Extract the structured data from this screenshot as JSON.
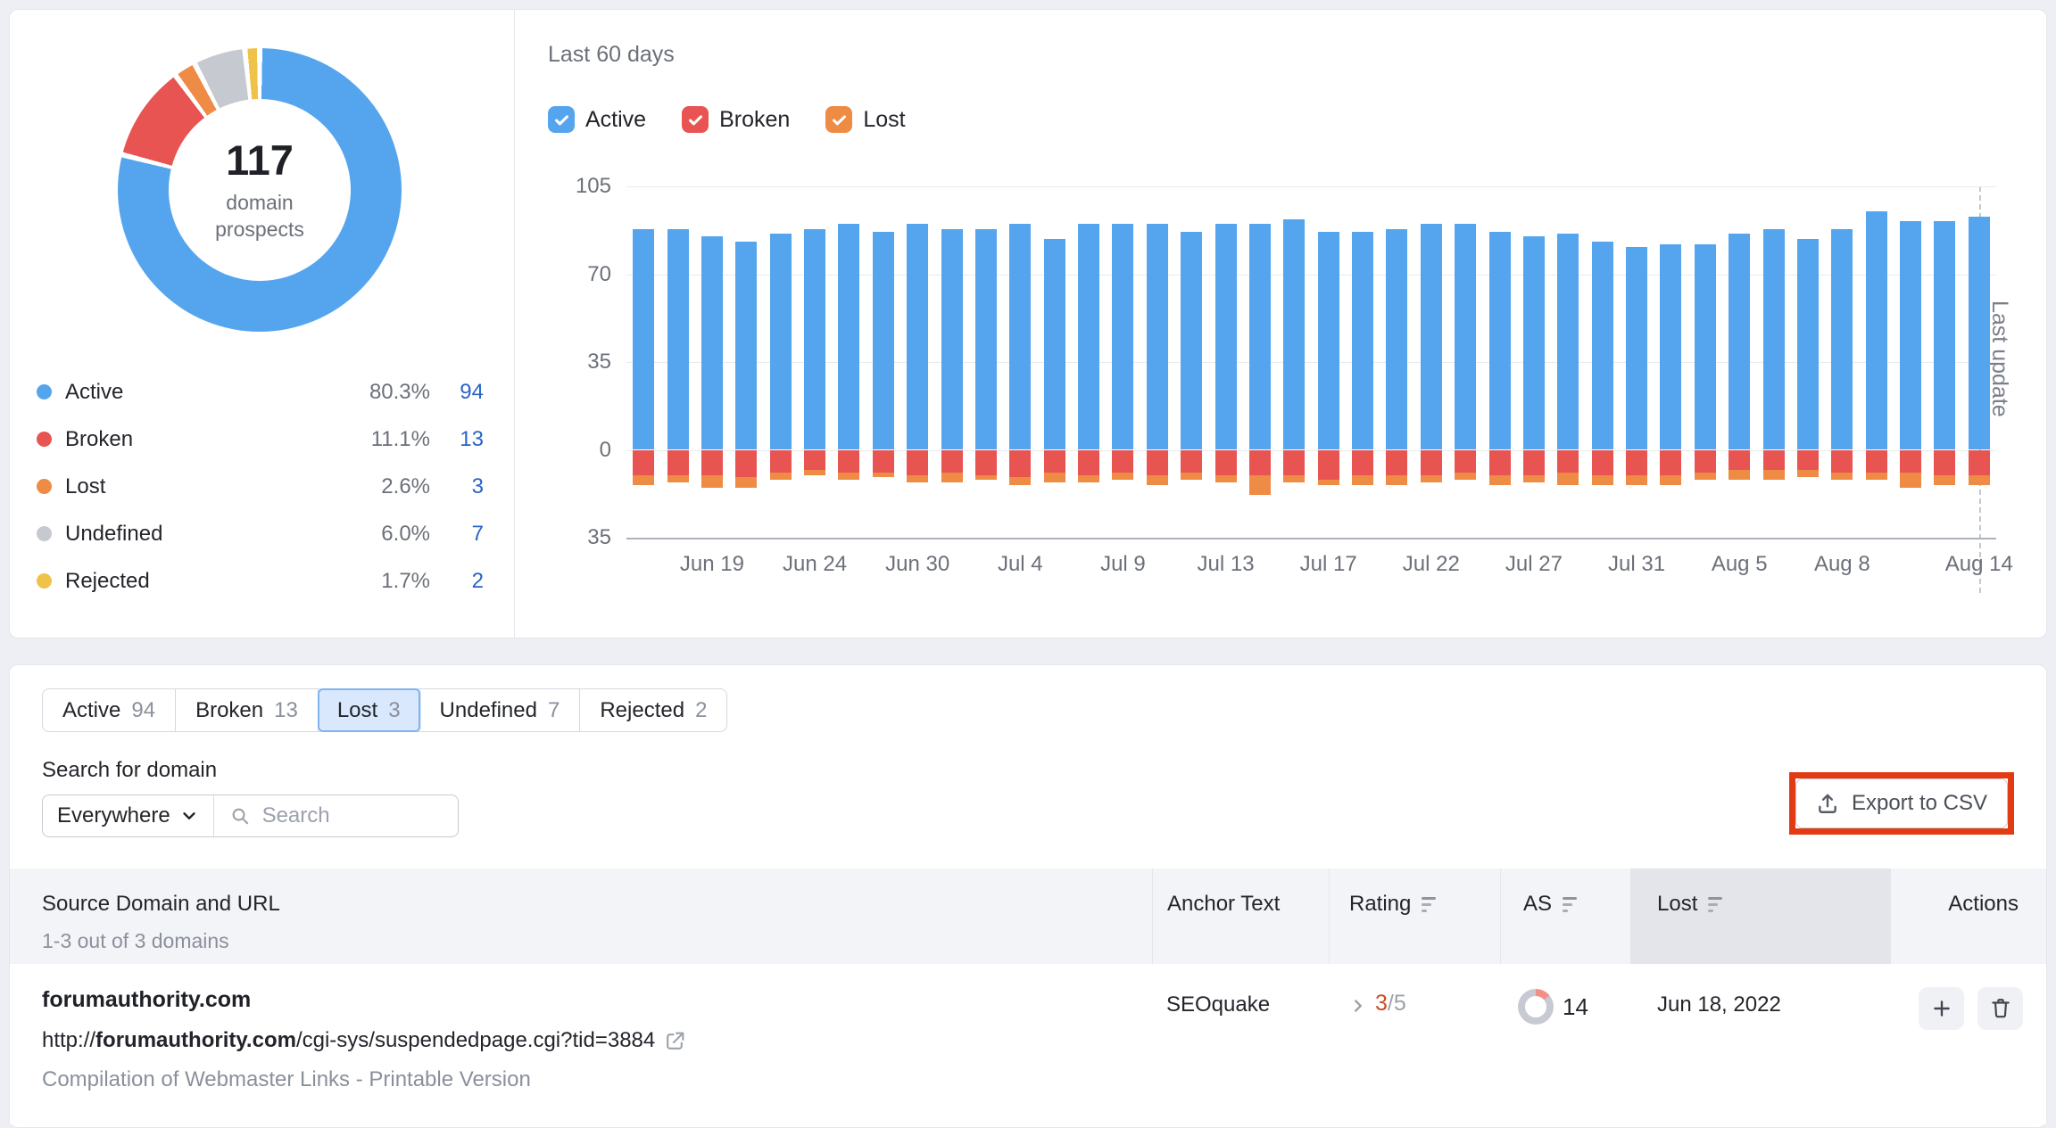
{
  "donut_card": {
    "center_value": "117",
    "center_label": "domain\nprospects",
    "legend": [
      {
        "label": "Active",
        "percent": "80.3%",
        "count": "94",
        "color": "#55A5EE"
      },
      {
        "label": "Broken",
        "percent": "11.1%",
        "count": "13",
        "color": "#E85452"
      },
      {
        "label": "Lost",
        "percent": "2.6%",
        "count": "3",
        "color": "#EE8B45"
      },
      {
        "label": "Undefined",
        "percent": "6.0%",
        "count": "7",
        "color": "#C6C9CF"
      },
      {
        "label": "Rejected",
        "percent": "1.7%",
        "count": "2",
        "color": "#EFC24A"
      }
    ]
  },
  "chart_card": {
    "title": "Last 60 days",
    "filters": [
      {
        "label": "Active",
        "color": "#55A5EE",
        "checked": true
      },
      {
        "label": "Broken",
        "color": "#E85452",
        "checked": true
      },
      {
        "label": "Lost",
        "color": "#EE8B45",
        "checked": true
      }
    ],
    "last_update_label": "Last update"
  },
  "chart_data": [
    {
      "type": "pie",
      "title": "117 domain prospects",
      "labels": [
        "Active",
        "Broken",
        "Lost",
        "Undefined",
        "Rejected"
      ],
      "values": [
        94,
        13,
        3,
        7,
        2
      ],
      "percents": [
        80.3,
        11.1,
        2.6,
        6.0,
        1.7
      ],
      "colors": [
        "#55A5EE",
        "#E85452",
        "#EE8B45",
        "#C6C9CF",
        "#EFC24A"
      ],
      "center_text": "117 domain prospects"
    },
    {
      "type": "bar",
      "stacked": true,
      "title": "Last 60 days",
      "ylim": [
        -35,
        105
      ],
      "yticks": [
        105,
        70,
        35,
        0,
        -35
      ],
      "ytick_labels": [
        "105",
        "70",
        "35",
        "0",
        "35"
      ],
      "grid": true,
      "x_label_indices": [
        2,
        5,
        8,
        11,
        14,
        17,
        20,
        23,
        26,
        29,
        32,
        35,
        39
      ],
      "x_labels": [
        "Jun 19",
        "Jun 24",
        "Jun 30",
        "Jul 4",
        "Jul 9",
        "Jul 13",
        "Jul 17",
        "Jul 22",
        "Jul 27",
        "Jul 31",
        "Aug 5",
        "Aug 8",
        "Aug 14"
      ],
      "series": [
        {
          "name": "Active",
          "color": "#55A5EE",
          "values": [
            88,
            88,
            85,
            83,
            86,
            88,
            90,
            87,
            90,
            88,
            88,
            90,
            84,
            90,
            90,
            90,
            87,
            90,
            90,
            92,
            87,
            87,
            88,
            90,
            90,
            87,
            85,
            86,
            83,
            81,
            82,
            82,
            86,
            88,
            84,
            88,
            95,
            91,
            91,
            93
          ]
        },
        {
          "name": "Broken",
          "color": "#E85452",
          "values": [
            -10,
            -10,
            -10,
            -11,
            -9,
            -8,
            -9,
            -9,
            -10,
            -9,
            -10,
            -11,
            -9,
            -10,
            -9,
            -10,
            -9,
            -10,
            -10,
            -10,
            -12,
            -10,
            -10,
            -10,
            -9,
            -10,
            -10,
            -9,
            -10,
            -10,
            -10,
            -9,
            -8,
            -8,
            -8,
            -9,
            -9,
            -9,
            -10,
            -10
          ]
        },
        {
          "name": "Lost",
          "color": "#EE8B45",
          "values": [
            -4,
            -3,
            -5,
            -4,
            -3,
            -2,
            -3,
            -2,
            -3,
            -4,
            -2,
            -3,
            -4,
            -3,
            -3,
            -4,
            -3,
            -3,
            -8,
            -3,
            -2,
            -4,
            -4,
            -3,
            -3,
            -4,
            -3,
            -5,
            -4,
            -4,
            -4,
            -3,
            -4,
            -4,
            -3,
            -3,
            -3,
            -6,
            -4,
            -4
          ]
        }
      ],
      "annotations": [
        "Last update"
      ]
    }
  ],
  "tabs": [
    {
      "label": "Active",
      "count": "94",
      "selected": false
    },
    {
      "label": "Broken",
      "count": "13",
      "selected": false
    },
    {
      "label": "Lost",
      "count": "3",
      "selected": true
    },
    {
      "label": "Undefined",
      "count": "7",
      "selected": false
    },
    {
      "label": "Rejected",
      "count": "2",
      "selected": false
    }
  ],
  "search": {
    "label": "Search for domain",
    "scope_value": "Everywhere",
    "placeholder": "Search"
  },
  "export": {
    "label": "Export to CSV"
  },
  "table": {
    "header": {
      "source": "Source Domain and URL",
      "source_sub": "1-3 out of 3 domains",
      "anchor": "Anchor Text",
      "rating": "Rating",
      "as": "AS",
      "lost": "Lost",
      "actions": "Actions"
    },
    "rows": [
      {
        "domain": "forumauthority.com",
        "url_prefix": "http://",
        "url_domain": "forumauthority.com",
        "url_path": "/cgi-sys/suspendedpage.cgi?tid=3884",
        "title": "Compilation of Webmaster Links - Printable Version",
        "anchor": "SEOquake",
        "rating_value": "3",
        "rating_total": "/5",
        "as_score": 14,
        "lost_date": "Jun 18, 2022"
      }
    ]
  },
  "colors": {
    "active_blue": "#55A5EE",
    "broken_red": "#E85452",
    "lost_orange": "#EE8B45",
    "undefined_grey": "#C6C9CF",
    "rejected_yellow": "#EFC24A",
    "link_blue": "#2A63C6",
    "annotation_red": "#E23A12",
    "rating_orange": "#C94F23",
    "as_arc": "#F29088",
    "as_ring": "#C7CAD3"
  }
}
